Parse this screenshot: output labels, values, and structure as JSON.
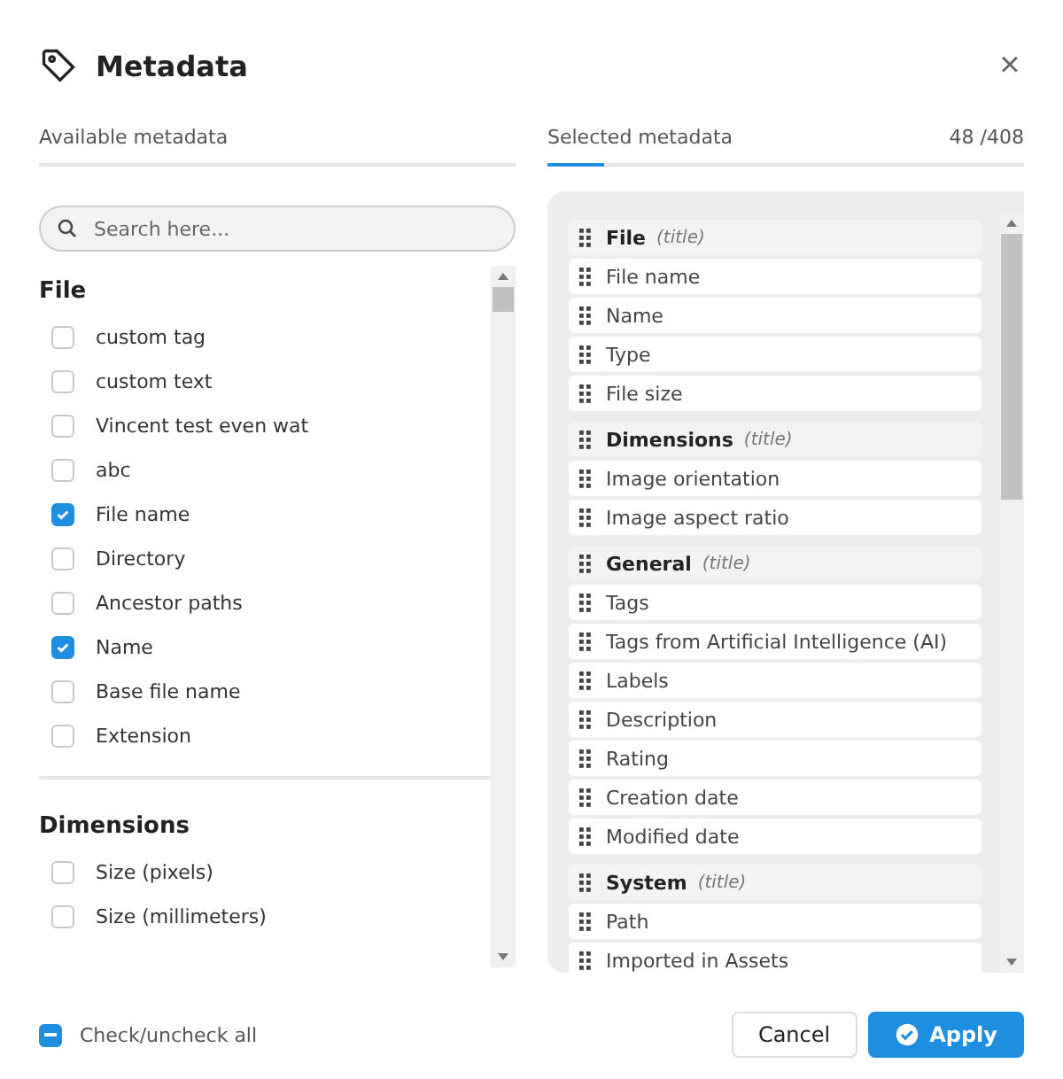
{
  "dialog": {
    "title": "Metadata",
    "close": "×"
  },
  "available": {
    "heading": "Available metadata",
    "search": {
      "placeholder": "Search here..."
    },
    "groups": [
      {
        "title": "File",
        "items": [
          {
            "label": "custom tag",
            "checked": false
          },
          {
            "label": "custom text",
            "checked": false
          },
          {
            "label": "Vincent test even wat",
            "checked": false
          },
          {
            "label": "abc",
            "checked": false
          },
          {
            "label": "File name",
            "checked": true
          },
          {
            "label": "Directory",
            "checked": false
          },
          {
            "label": "Ancestor paths",
            "checked": false
          },
          {
            "label": "Name",
            "checked": true
          },
          {
            "label": "Base file name",
            "checked": false
          },
          {
            "label": "Extension",
            "checked": false
          }
        ]
      },
      {
        "title": "Dimensions",
        "items": [
          {
            "label": "Size (pixels)",
            "checked": false
          },
          {
            "label": "Size (millimeters)",
            "checked": false
          }
        ]
      }
    ]
  },
  "selected": {
    "heading": "Selected metadata",
    "count": "48 /408",
    "rows": [
      {
        "kind": "title",
        "label": "File",
        "suffix": "(title)"
      },
      {
        "kind": "item",
        "label": "File name"
      },
      {
        "kind": "item",
        "label": "Name"
      },
      {
        "kind": "item",
        "label": "Type"
      },
      {
        "kind": "item",
        "label": "File size"
      },
      {
        "kind": "title",
        "label": "Dimensions",
        "suffix": "(title)"
      },
      {
        "kind": "item",
        "label": "Image orientation"
      },
      {
        "kind": "item",
        "label": "Image aspect ratio"
      },
      {
        "kind": "title",
        "label": "General",
        "suffix": "(title)"
      },
      {
        "kind": "item",
        "label": "Tags"
      },
      {
        "kind": "item",
        "label": "Tags from Artificial Intelligence (AI)"
      },
      {
        "kind": "item",
        "label": "Labels"
      },
      {
        "kind": "item",
        "label": "Description"
      },
      {
        "kind": "item",
        "label": "Rating"
      },
      {
        "kind": "item",
        "label": "Creation date"
      },
      {
        "kind": "item",
        "label": "Modified date"
      },
      {
        "kind": "title",
        "label": "System",
        "suffix": "(title)"
      },
      {
        "kind": "item",
        "label": "Path"
      },
      {
        "kind": "item",
        "label": "Imported in Assets"
      }
    ]
  },
  "footer": {
    "check_all": {
      "label": "Check/uncheck all",
      "indeterminate": true
    },
    "buttons": [
      {
        "label": "Cancel",
        "kind": "secondary"
      },
      {
        "label": "Apply",
        "kind": "primary"
      }
    ]
  }
}
